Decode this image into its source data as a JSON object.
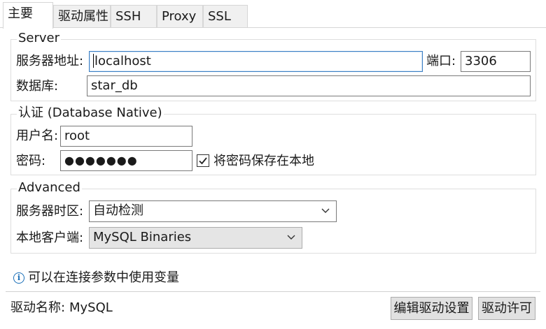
{
  "tabs": [
    "主要",
    "驱动属性",
    "SSH",
    "Proxy",
    "SSL"
  ],
  "server": {
    "legend": "Server",
    "host_label": "服务器地址:",
    "host_value": "localhost",
    "port_label": "端口:",
    "port_value": "3306",
    "db_label": "数据库:",
    "db_value": "star_db"
  },
  "auth": {
    "legend": "认证 (Database Native)",
    "user_label": "用户名:",
    "user_value": "root",
    "pwd_label": "密码:",
    "pwd_mask": "●●●●●●●",
    "save_pwd_label": "将密码保存在本地",
    "save_pwd_checked": true
  },
  "advanced": {
    "legend": "Advanced",
    "tz_label": "服务器时区:",
    "tz_value": "自动检测",
    "client_label": "本地客户端:",
    "client_value": "MySQL Binaries"
  },
  "info_text": "可以在连接参数中使用变量",
  "footer": {
    "driver_label": "驱动名称:",
    "driver_value": "MySQL",
    "edit_driver_button": "编辑驱动设置",
    "license_button": "驱动许可"
  },
  "colors": {
    "accent": "#1a6fb8",
    "focus_border": "#3c7fc4"
  }
}
